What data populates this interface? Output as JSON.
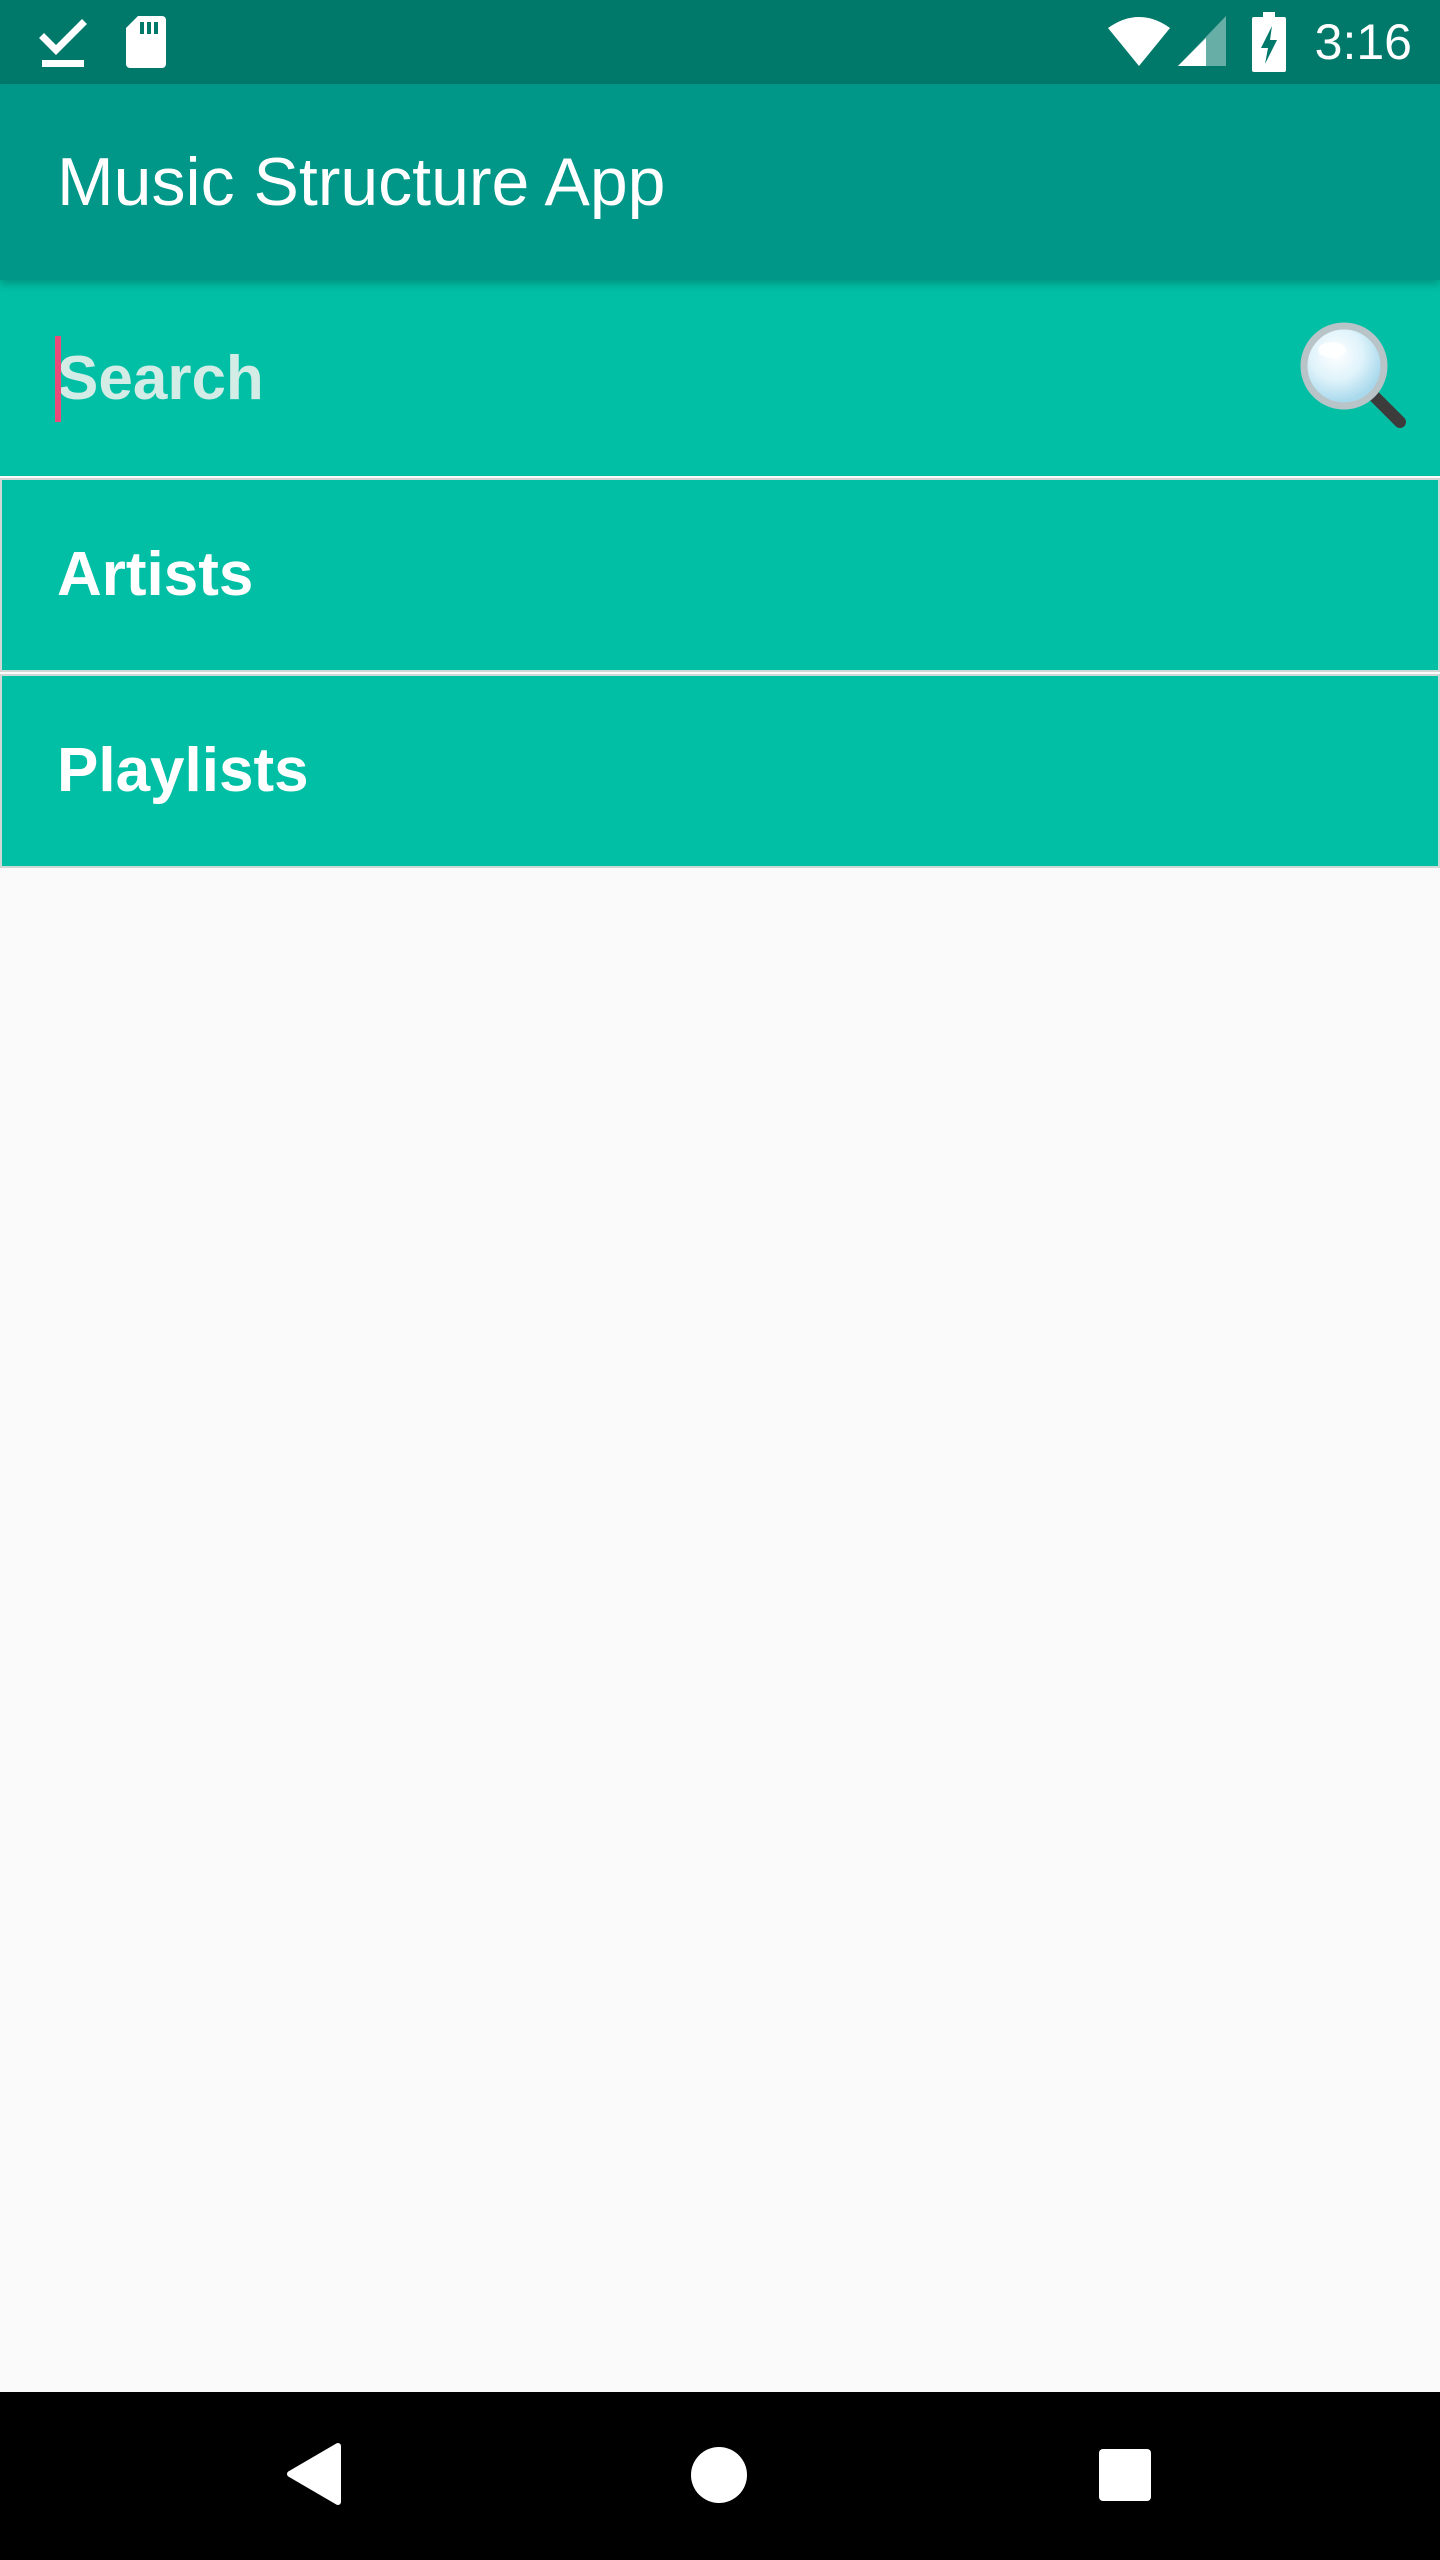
{
  "status_bar": {
    "time": "3:16",
    "icons": [
      "download-done-icon",
      "sd-card-icon",
      "wifi-icon",
      "cellular-signal-icon",
      "battery-charging-icon"
    ]
  },
  "app_bar": {
    "title": "Music Structure App"
  },
  "search": {
    "placeholder": "Search",
    "value": "",
    "icon": "magnifier-icon"
  },
  "categories": [
    {
      "label": "Artists"
    },
    {
      "label": "Playlists"
    }
  ],
  "nav_bar": {
    "buttons": [
      "back-icon",
      "home-icon",
      "recents-icon"
    ]
  },
  "colors": {
    "status_bar": "#00796b",
    "app_bar": "#009688",
    "list_background": "#00bfa5",
    "page_background": "#fafafa",
    "cursor": "#e84a7a",
    "nav_bar": "#000000"
  }
}
